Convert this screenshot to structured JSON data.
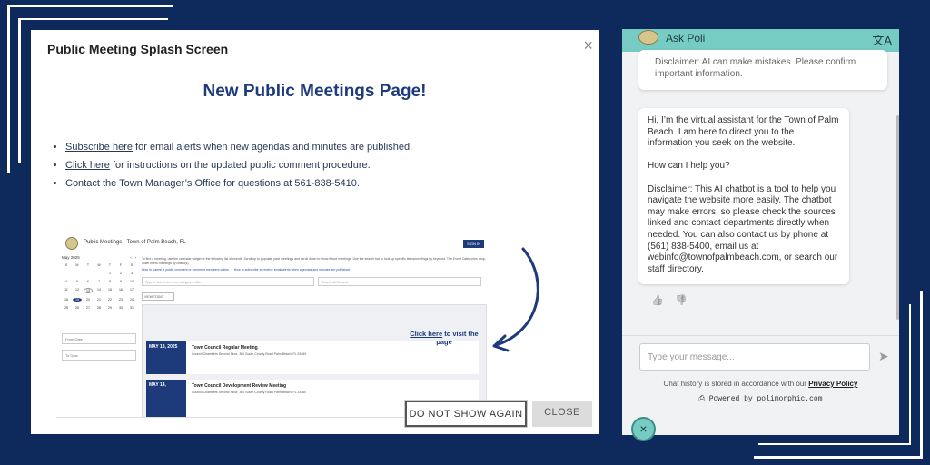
{
  "modal": {
    "title": "Public Meeting Splash Screen",
    "close_glyph": "×",
    "heading": "New Public Meetings Page!",
    "bullets": {
      "b1_link": "Subscribe here",
      "b1_text": " for email alerts when new agendas and minutes are published.",
      "b2_link": "Click here",
      "b2_text": " for instructions on the updated public comment procedure.",
      "b3_text": "Contact the Town Manager’s Office for questions at 561-838-5410."
    },
    "preview": {
      "title": "Public Meetings - Town of Palm Beach, FL",
      "signin": "SIGN IN",
      "intro": "To find a meeting, use the calendar widget or the following list of events. Scroll up to populate past meetings and scroll down to show future meetings. Use the search bar to look up specific items/meetings by keyword. The Event Categories drop-down filters meetings by board(s).",
      "link1": "How to submit a public comment or comment members online",
      "link2": "How to subscribe to receive email alerts when agendas and minutes are published",
      "calendar_month": "May 2025",
      "calendar_days": [
        "S",
        "M",
        "T",
        "W",
        "T",
        "F",
        "S",
        "",
        "",
        "",
        "",
        "1",
        "2",
        "3",
        "4",
        "5",
        "6",
        "7",
        "8",
        "9",
        "10",
        "11",
        "12",
        "13",
        "14",
        "15",
        "16",
        "17",
        "18",
        "19",
        "20",
        "21",
        "22",
        "23",
        "24",
        "25",
        "26",
        "27",
        "28",
        "29",
        "30",
        "31"
      ],
      "from_date": "From Date",
      "to_date": "To Date",
      "event_categories_placeholder": "Type or select an event category to filter",
      "search_placeholder": "Search all Content",
      "view_today": "VIEW TODAY",
      "rows": [
        {
          "date": "MAY 13, 2025",
          "title": "Town Council Regular Meeting",
          "address": "Council Chambers Second Floor, 360 South County Road Palm Beach, FL 33480"
        },
        {
          "date": "MAY 14,",
          "title": "Town Council Development Review Meeting",
          "address": "Council Chambers Second Floor, 360 South County Road Palm Beach, FL 33480"
        }
      ],
      "click_link": "Click here",
      "click_text": " to visit the page"
    },
    "buttons": {
      "dont_show": "DO NOT SHOW AGAIN",
      "close": "CLOSE"
    }
  },
  "chat": {
    "name": "Ask Poli",
    "translate_glyph": "文A",
    "disclaimer_top": "Disclaimer: AI can make mistakes. Please confirm important information.",
    "message_p1": "Hi, I’m the virtual assistant for the Town of Palm Beach. I am here to direct you to the information you seek on the website.",
    "message_p2": "How can I help you?",
    "message_p3": "Disclaimer: This AI chatbot is a tool to help you navigate the website more easily. The chatbot may make errors, so please check the sources linked and contact departments directly when needed. You can also contact us by phone at (561) 838-5400, email us at webinfo@townofpalmbeach.com, or search our staff directory.",
    "thumbs_up": "👍",
    "thumbs_down": "👎",
    "input_placeholder": "Type your message...",
    "send_glyph": "➤",
    "history_text": "Chat history is stored in accordance with our ",
    "history_link": "Privacy Policy",
    "powered": "Powered by polimorphic.com",
    "fab_glyph": "×"
  },
  "colors": {
    "background": "#0e2a5c",
    "chat_header": "#76ccc2",
    "heading_blue": "#1d3a7a"
  }
}
